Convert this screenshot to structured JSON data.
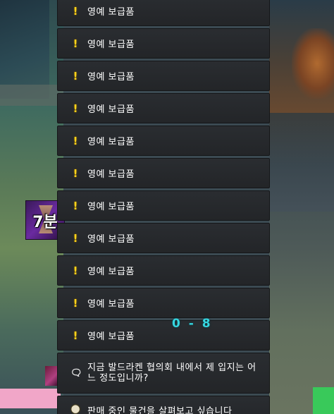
{
  "quests": [
    {
      "icon": "exclamation-icon",
      "label": "영예 보급품"
    },
    {
      "icon": "exclamation-icon",
      "label": "영예 보급품"
    },
    {
      "icon": "exclamation-icon",
      "label": "영예 보급품"
    },
    {
      "icon": "exclamation-icon",
      "label": "영예 보급품"
    },
    {
      "icon": "exclamation-icon",
      "label": "영예 보급품"
    },
    {
      "icon": "exclamation-icon",
      "label": "영예 보급품"
    },
    {
      "icon": "exclamation-icon",
      "label": "영예 보급품"
    },
    {
      "icon": "exclamation-icon",
      "label": "영예 보급품"
    },
    {
      "icon": "exclamation-icon",
      "label": "영예 보급품"
    },
    {
      "icon": "exclamation-icon",
      "label": "영예 보급품"
    },
    {
      "icon": "exclamation-icon",
      "label": "영예 보급품"
    }
  ],
  "gossip": [
    {
      "icon": "chat-bubble-icon",
      "label": "지금 발드라켄 협의회 내에서 제 입지는 어느 정도입니까?"
    },
    {
      "icon": "merchant-icon",
      "label": "판매 중인 물건을 살펴보고 싶습니다"
    }
  ],
  "timer": {
    "label": "7분"
  },
  "score": {
    "text": "0 - 8"
  },
  "colors": {
    "quest_icon": "#ffd21a",
    "score": "#35d6e0",
    "row_bg": "#2a2d31"
  }
}
